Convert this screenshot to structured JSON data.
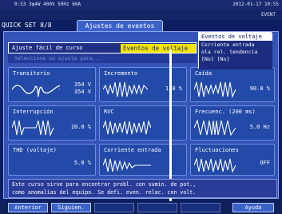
{
  "header": {
    "topbar_text": "0:53 3φ4W 400V 50Hz 60A",
    "date_text": "2012-01-17 10:55",
    "status_text": "QUICK SET 8/8",
    "event_text": "EVENT"
  },
  "tab": {
    "quickset_label": "QUICK SET 8/8",
    "title": "Ajustes de eventos"
  },
  "easy_setting": {
    "label": "Ajuste fácil de curso",
    "value": "Eventos de voltaje"
  },
  "shadow_row": "Seleccione un ajuste para...",
  "popup": {
    "title": "Eventos de voltaje",
    "lines": [
      "Corriente entrada",
      "ola rel. tendencia",
      "[No] [No]"
    ]
  },
  "cells": [
    {
      "label": "Transitorio",
      "value": "354 V\n354 V"
    },
    {
      "label": "Incremento",
      "value": "110 %"
    },
    {
      "label": "Caída",
      "value": "90.0 %"
    },
    {
      "label": "Interrupción",
      "value": "10.0 %"
    },
    {
      "label": "RVC",
      "value": ""
    },
    {
      "label": "Frecuenc. (200 ms)",
      "value": "5.0 Hz"
    },
    {
      "label": "THD (voltaje)",
      "value": "5.0 %"
    },
    {
      "label": "Corriente entrada",
      "value": ""
    },
    {
      "label": "Fluctuaciones",
      "value": "OFF"
    }
  ],
  "help": {
    "line1": "Este curso sirve para encontrar probl. con sumin. de pot.,",
    "line2": "como anomalías del equipo. Se defi. even. relac. con volt."
  },
  "fkeys": {
    "prev": "Anterior",
    "next": "Siguien.",
    "help": "Ayuda"
  }
}
